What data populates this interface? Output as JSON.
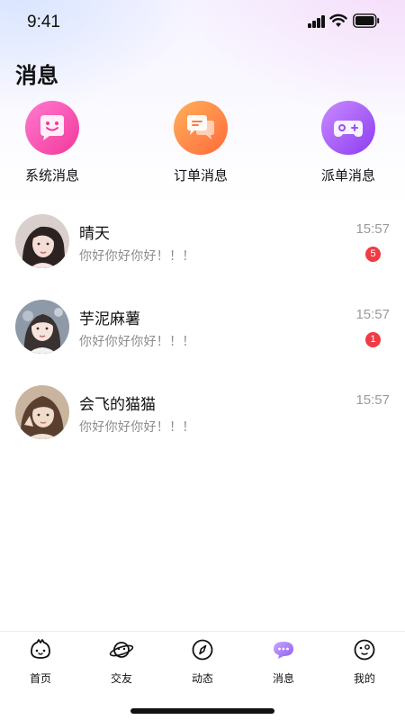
{
  "status_bar": {
    "time": "9:41"
  },
  "header": {
    "title": "消息"
  },
  "quick_actions": [
    {
      "label": "系统消息",
      "icon": "smile-chat-icon"
    },
    {
      "label": "订单消息",
      "icon": "chat-bubbles-icon"
    },
    {
      "label": "派单消息",
      "icon": "gamepad-icon"
    }
  ],
  "conversations": [
    {
      "name": "晴天",
      "preview": "你好你好你好！！！",
      "time": "15:57",
      "unread": "5"
    },
    {
      "name": "芋泥麻薯",
      "preview": "你好你好你好！！！",
      "time": "15:57",
      "unread": "1"
    },
    {
      "name": "会飞的猫猫",
      "preview": "你好你好你好！！！",
      "time": "15:57",
      "unread": ""
    }
  ],
  "tab_bar": {
    "items": [
      {
        "label": "首页",
        "icon": "cute-face-icon"
      },
      {
        "label": "交友",
        "icon": "planet-face-icon"
      },
      {
        "label": "动态",
        "icon": "compass-icon"
      },
      {
        "label": "消息",
        "icon": "message-bubble-icon",
        "active": true
      },
      {
        "label": "我的",
        "icon": "profile-face-icon"
      }
    ]
  },
  "colors": {
    "badge": "#ef3b43",
    "system_icon": "#f2389a",
    "order_icon": "#ff6a3c",
    "dispatch_icon": "#8c3df0",
    "active_tab": "#9b6cf5"
  }
}
